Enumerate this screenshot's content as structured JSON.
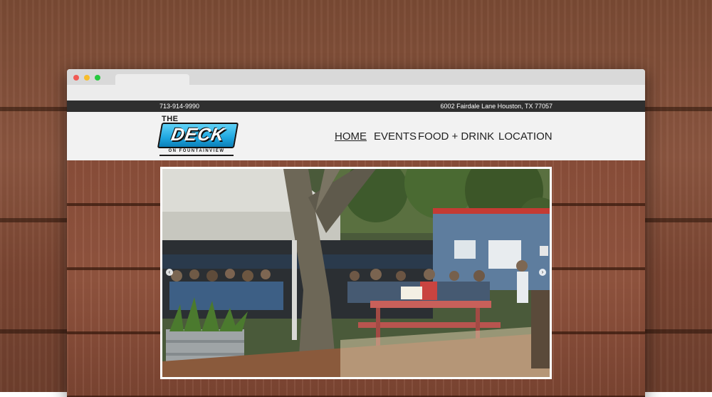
{
  "browser": {},
  "site": {
    "phone": "713-914-9990",
    "address": "6002 Fairdale Lane Houston, TX 77057",
    "logo": {
      "top": "THE",
      "main": "DECK",
      "sub": "ON FOUNTAINVIEW"
    },
    "nav": [
      {
        "label": "HOME"
      },
      {
        "label": "EVENTS"
      },
      {
        "label": "FOOD + DRINK"
      },
      {
        "label": "LOCATION"
      }
    ]
  },
  "slider": {
    "prev_glyph": "‹",
    "next_glyph": "›",
    "image_icon": "outdoor-patio-photo"
  },
  "colors": {
    "topbar": "#2f2f2f",
    "header": "#f2f2f2",
    "logo_blue": "#1fa7e0",
    "wood": "#8b4f3a"
  }
}
